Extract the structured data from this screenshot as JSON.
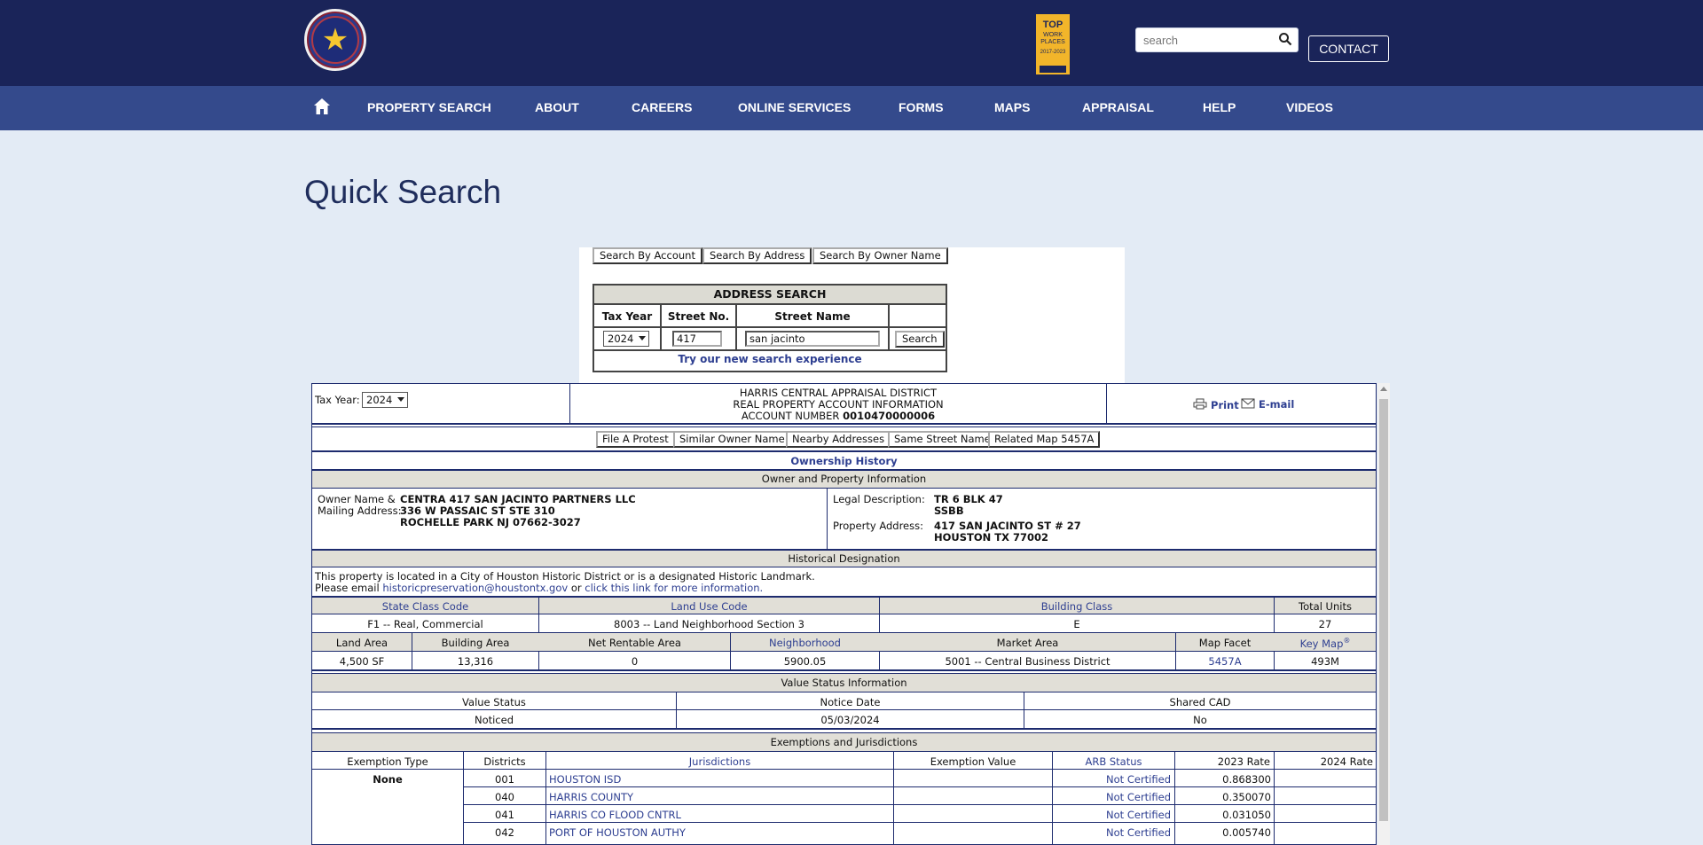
{
  "header": {
    "search_placeholder": "search",
    "contact_label": "CONTACT",
    "topwork_line1": "TOP",
    "topwork_line2": "WORK\nPLACES",
    "topwork_line3": "2017-2023"
  },
  "nav": {
    "items": [
      "PROPERTY SEARCH",
      "ABOUT",
      "CAREERS",
      "ONLINE SERVICES",
      "FORMS",
      "MAPS",
      "APPRAISAL",
      "HELP",
      "VIDEOS"
    ]
  },
  "page_title": "Quick Search",
  "search": {
    "buttons": [
      "Search By Account",
      "Search By Address",
      "Search By Owner Name"
    ],
    "title": "ADDRESS SEARCH",
    "headers": [
      "Tax Year",
      "Street No.",
      "Street Name"
    ],
    "tax_year": "2024",
    "street_no": "417",
    "street_name": "san jacinto",
    "search_button": "Search",
    "new_experience_link": "Try our new search experience"
  },
  "account": {
    "tax_year_label": "Tax Year:",
    "tax_year": "2024",
    "district_name": "HARRIS CENTRAL APPRAISAL DISTRICT",
    "info_title": "REAL PROPERTY ACCOUNT INFORMATION",
    "account_label": "ACCOUNT NUMBER",
    "account_number": "0010470000006",
    "print_label": "Print",
    "email_label": "E-mail",
    "action_buttons": [
      "File A Protest",
      "Similar Owner Name",
      "Nearby Addresses",
      "Same Street Name",
      "Related Map 5457A"
    ],
    "ownership_history_link": "Ownership History",
    "owner_section_title": "Owner and Property Information",
    "owner_label_1": "Owner Name &",
    "owner_label_2": "Mailing Address:",
    "owner_name": "CENTRA 417 SAN JACINTO PARTNERS LLC",
    "owner_address_1": "336 W PASSAIC ST STE 310",
    "owner_address_2": "ROCHELLE PARK NJ 07662-3027",
    "legal_label": "Legal Description:",
    "legal_1": "TR 6 BLK 47",
    "legal_2": "SSBB",
    "property_address_label": "Property Address:",
    "property_address_1": "417 SAN JACINTO ST # 27",
    "property_address_2": "HOUSTON TX 77002",
    "historical_title": "Historical Designation",
    "historical_text": "This property is located in a City of Houston Historic District or is a designated Historic Landmark.",
    "historical_email_prefix": "Please email",
    "historical_email": "historicpreservation@houstontx.gov",
    "historical_or": "or",
    "historical_link": "click this link for more information.",
    "class_headers": [
      "State Class Code",
      "Land Use Code",
      "Building Class",
      "Total Units"
    ],
    "class_values": [
      "F1 -- Real, Commercial",
      "8003 -- Land Neighborhood Section 3",
      "E",
      "27"
    ],
    "area_headers": [
      "Land Area",
      "Building Area",
      "Net Rentable Area",
      "Neighborhood",
      "Market Area",
      "Map Facet",
      "Key Map"
    ],
    "key_map_sup": "®",
    "area_values": [
      "4,500 SF",
      "13,316",
      "0",
      "5900.05",
      "5001 -- Central Business District",
      "5457A",
      "493M"
    ],
    "value_status_title": "Value Status Information",
    "value_status_headers": [
      "Value Status",
      "Notice Date",
      "Shared CAD"
    ],
    "value_status_values": [
      "Noticed",
      "05/03/2024",
      "No"
    ],
    "exemptions_title": "Exemptions and Jurisdictions",
    "exemption_headers": [
      "Exemption Type",
      "Districts",
      "Jurisdictions",
      "Exemption Value",
      "ARB Status",
      "2023 Rate",
      "2024 Rate"
    ],
    "exemption_type": "None",
    "jurisdictions": [
      {
        "district": "001",
        "name": "HOUSTON ISD",
        "arb": "Not Certified",
        "rate2023": "0.868300"
      },
      {
        "district": "040",
        "name": "HARRIS COUNTY",
        "arb": "Not Certified",
        "rate2023": "0.350070"
      },
      {
        "district": "041",
        "name": "HARRIS CO FLOOD CNTRL",
        "arb": "Not Certified",
        "rate2023": "0.031050"
      },
      {
        "district": "042",
        "name": "PORT OF HOUSTON AUTHY",
        "arb": "Not Certified",
        "rate2023": "0.005740"
      }
    ]
  }
}
